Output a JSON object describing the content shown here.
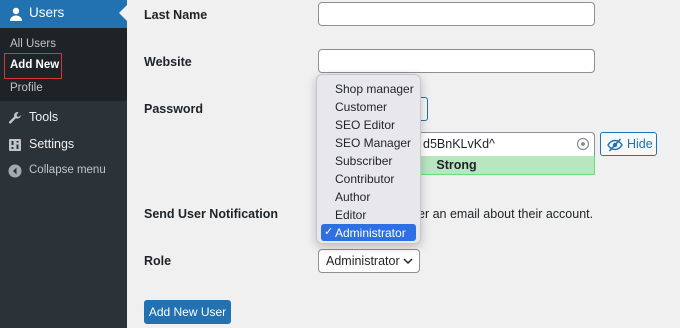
{
  "sidebar": {
    "users_label": "Users",
    "submenu": {
      "all_users": "All Users",
      "add_new": "Add New",
      "profile": "Profile"
    },
    "tools_label": "Tools",
    "settings_label": "Settings",
    "collapse_label": "Collapse menu"
  },
  "form": {
    "last_name_label": "Last Name",
    "last_name_value": "",
    "website_label": "Website",
    "website_value": "",
    "password_label": "Password",
    "password_visible_text": "d5BnKLvKd^",
    "password_strength": "Strong",
    "hide_button": "Hide",
    "notification_label": "Send User Notification",
    "notification_text": "er an email about their account.",
    "role_label": "Role",
    "role_value": "Administrator",
    "submit_button": "Add New User"
  },
  "role_dropdown": {
    "options": [
      "Shop manager",
      "Customer",
      "SEO Editor",
      "SEO Manager",
      "Subscriber",
      "Contributor",
      "Author",
      "Editor",
      "Administrator"
    ],
    "selected": "Administrator",
    "check_glyph": "✓"
  },
  "colors": {
    "sidebar_bg": "#2c3338",
    "active_blue": "#2271b1",
    "highlight_red": "#d63638",
    "strength_green": "#b8e6bf",
    "selected_option": "#2f6fe4"
  },
  "icons": {
    "users": "users-icon",
    "tools": "wrench-icon",
    "settings": "settings-icon",
    "collapse": "collapse-arrow-icon",
    "password_eye": "eye-icon",
    "hide": "eye-slash-icon",
    "select": "chevron-down-icon"
  }
}
